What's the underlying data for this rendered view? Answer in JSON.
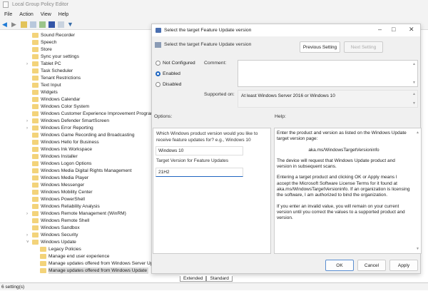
{
  "window": {
    "title": "Local Group Policy Editor"
  },
  "menu": [
    "File",
    "Action",
    "View",
    "Help"
  ],
  "tree": {
    "items": [
      {
        "label": "Sound Recorder",
        "expander": ""
      },
      {
        "label": "Speech",
        "expander": ""
      },
      {
        "label": "Store",
        "expander": ""
      },
      {
        "label": "Sync your settings",
        "expander": ""
      },
      {
        "label": "Tablet PC",
        "expander": ">"
      },
      {
        "label": "Task Scheduler",
        "expander": ""
      },
      {
        "label": "Tenant Restrictions",
        "expander": ""
      },
      {
        "label": "Text Input",
        "expander": ""
      },
      {
        "label": "Widgets",
        "expander": ""
      },
      {
        "label": "Windows Calendar",
        "expander": ""
      },
      {
        "label": "Windows Color System",
        "expander": ""
      },
      {
        "label": "Windows Customer Experience Improvement Program",
        "expander": ""
      },
      {
        "label": "Windows Defender SmartScreen",
        "expander": ">"
      },
      {
        "label": "Windows Error Reporting",
        "expander": ">"
      },
      {
        "label": "Windows Game Recording and Broadcasting",
        "expander": ""
      },
      {
        "label": "Windows Hello for Business",
        "expander": ""
      },
      {
        "label": "Windows Ink Workspace",
        "expander": ""
      },
      {
        "label": "Windows Installer",
        "expander": ""
      },
      {
        "label": "Windows Logon Options",
        "expander": ""
      },
      {
        "label": "Windows Media Digital Rights Management",
        "expander": ""
      },
      {
        "label": "Windows Media Player",
        "expander": ""
      },
      {
        "label": "Windows Messenger",
        "expander": ""
      },
      {
        "label": "Windows Mobility Center",
        "expander": ""
      },
      {
        "label": "Windows PowerShell",
        "expander": ""
      },
      {
        "label": "Windows Reliability Analysis",
        "expander": ""
      },
      {
        "label": "Windows Remote Management (WinRM)",
        "expander": ">"
      },
      {
        "label": "Windows Remote Shell",
        "expander": ""
      },
      {
        "label": "Windows Sandbox",
        "expander": ""
      },
      {
        "label": "Windows Security",
        "expander": ">"
      },
      {
        "label": "Windows Update",
        "expander": "v"
      }
    ],
    "children": [
      {
        "label": "Legacy Policies"
      },
      {
        "label": "Manage end user experience"
      },
      {
        "label": "Manage updates offered from Windows Server Update Service"
      },
      {
        "label": "Manage updates offered from Windows Update",
        "selected": true
      }
    ]
  },
  "tabs": [
    "Extended",
    "Standard"
  ],
  "status": "6 setting(s)",
  "dialog": {
    "title": "Select the target Feature Update version",
    "setting_name": "Select the target Feature Update version",
    "previous_label": "Previous Setting",
    "next_label": "Next Setting",
    "radios": [
      "Not Configured",
      "Enabled",
      "Disabled"
    ],
    "selected_radio": "Enabled",
    "comment_label": "Comment:",
    "comment_value": "",
    "supported_label": "Supported on:",
    "supported_value": "At least Windows Server 2016 or Windows 10",
    "options_label": "Options:",
    "help_label": "Help:",
    "options": {
      "product_prompt": "Which Windows product version would you like to receive feature updates for? e.g., Windows 10",
      "product_value": "Windows 10",
      "version_label": "Target Version for Feature Updates",
      "version_value": "21H2"
    },
    "help": [
      "Enter the product and version as listed on the Windows Update target version page:",
      "aka.ms/WindowsTargetVersioninfo",
      "The device will request that Windows Update product and version in subsequent scans.",
      "Entering a target product and clicking OK or Apply means I accept the Microsoft Software License Terms for it found at aka.ms/WindowsTargetVersioninfo. If an organization is licensing the software, I am authorized to bind the organization.",
      "If you enter an invalid value, you will remain on your current version until you correct the values to a supported product and version."
    ],
    "ok_label": "OK",
    "cancel_label": "Cancel",
    "apply_label": "Apply"
  }
}
